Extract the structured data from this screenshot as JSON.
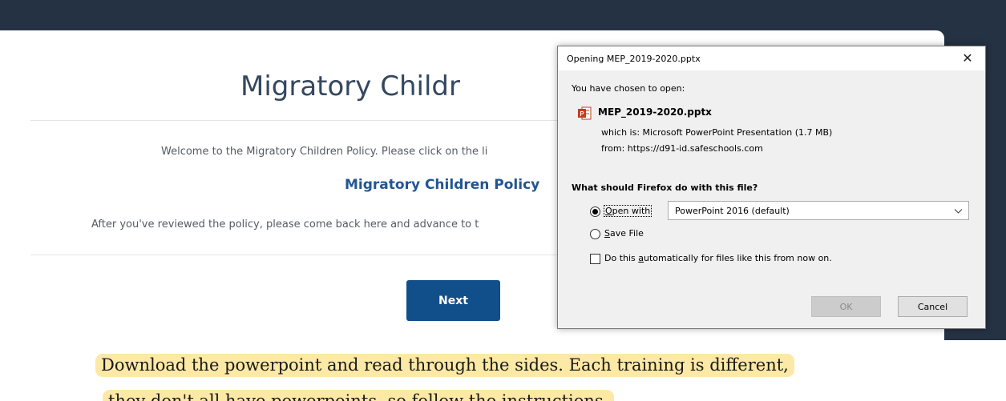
{
  "course_page": {
    "title": "Migratory Childr",
    "welcome_text": "Welcome to the Migratory Children Policy. Please click on the li",
    "policy_link": "Migratory Children Policy",
    "after_text": "After you've reviewed the policy, please come back here and advance to t",
    "next_button": "Next"
  },
  "dialog": {
    "title": "Opening MEP_2019-2020.pptx",
    "close_glyph": "✕",
    "chosen_text": "You have chosen to open:",
    "file_icon": "powerpoint-file-icon",
    "file_name": "MEP_2019-2020.pptx",
    "which_is": "which is:  Microsoft PowerPoint Presentation (1.7 MB)",
    "from": "from:  https://d91-id.safeschools.com",
    "question": "What should Firefox do with this file?",
    "options": {
      "open_with": {
        "label": "Open with",
        "checked": true
      },
      "save_file": {
        "label": "Save File",
        "checked": false
      }
    },
    "app_select": "PowerPoint 2016 (default)",
    "auto_checkbox": {
      "label": "Do this automatically for files like this from now on.",
      "checked": false
    },
    "ok_button": "OK",
    "cancel_button": "Cancel"
  },
  "caption": {
    "line1": "Download the powerpoint and read through the sides.  Each training is different,",
    "line2": "they don't all have powerpoints, so follow the instructions."
  },
  "colors": {
    "backdrop": "#253244",
    "title": "#34475f",
    "link": "#215690",
    "next_button": "#114f8a",
    "highlight": "#fde9a6"
  }
}
